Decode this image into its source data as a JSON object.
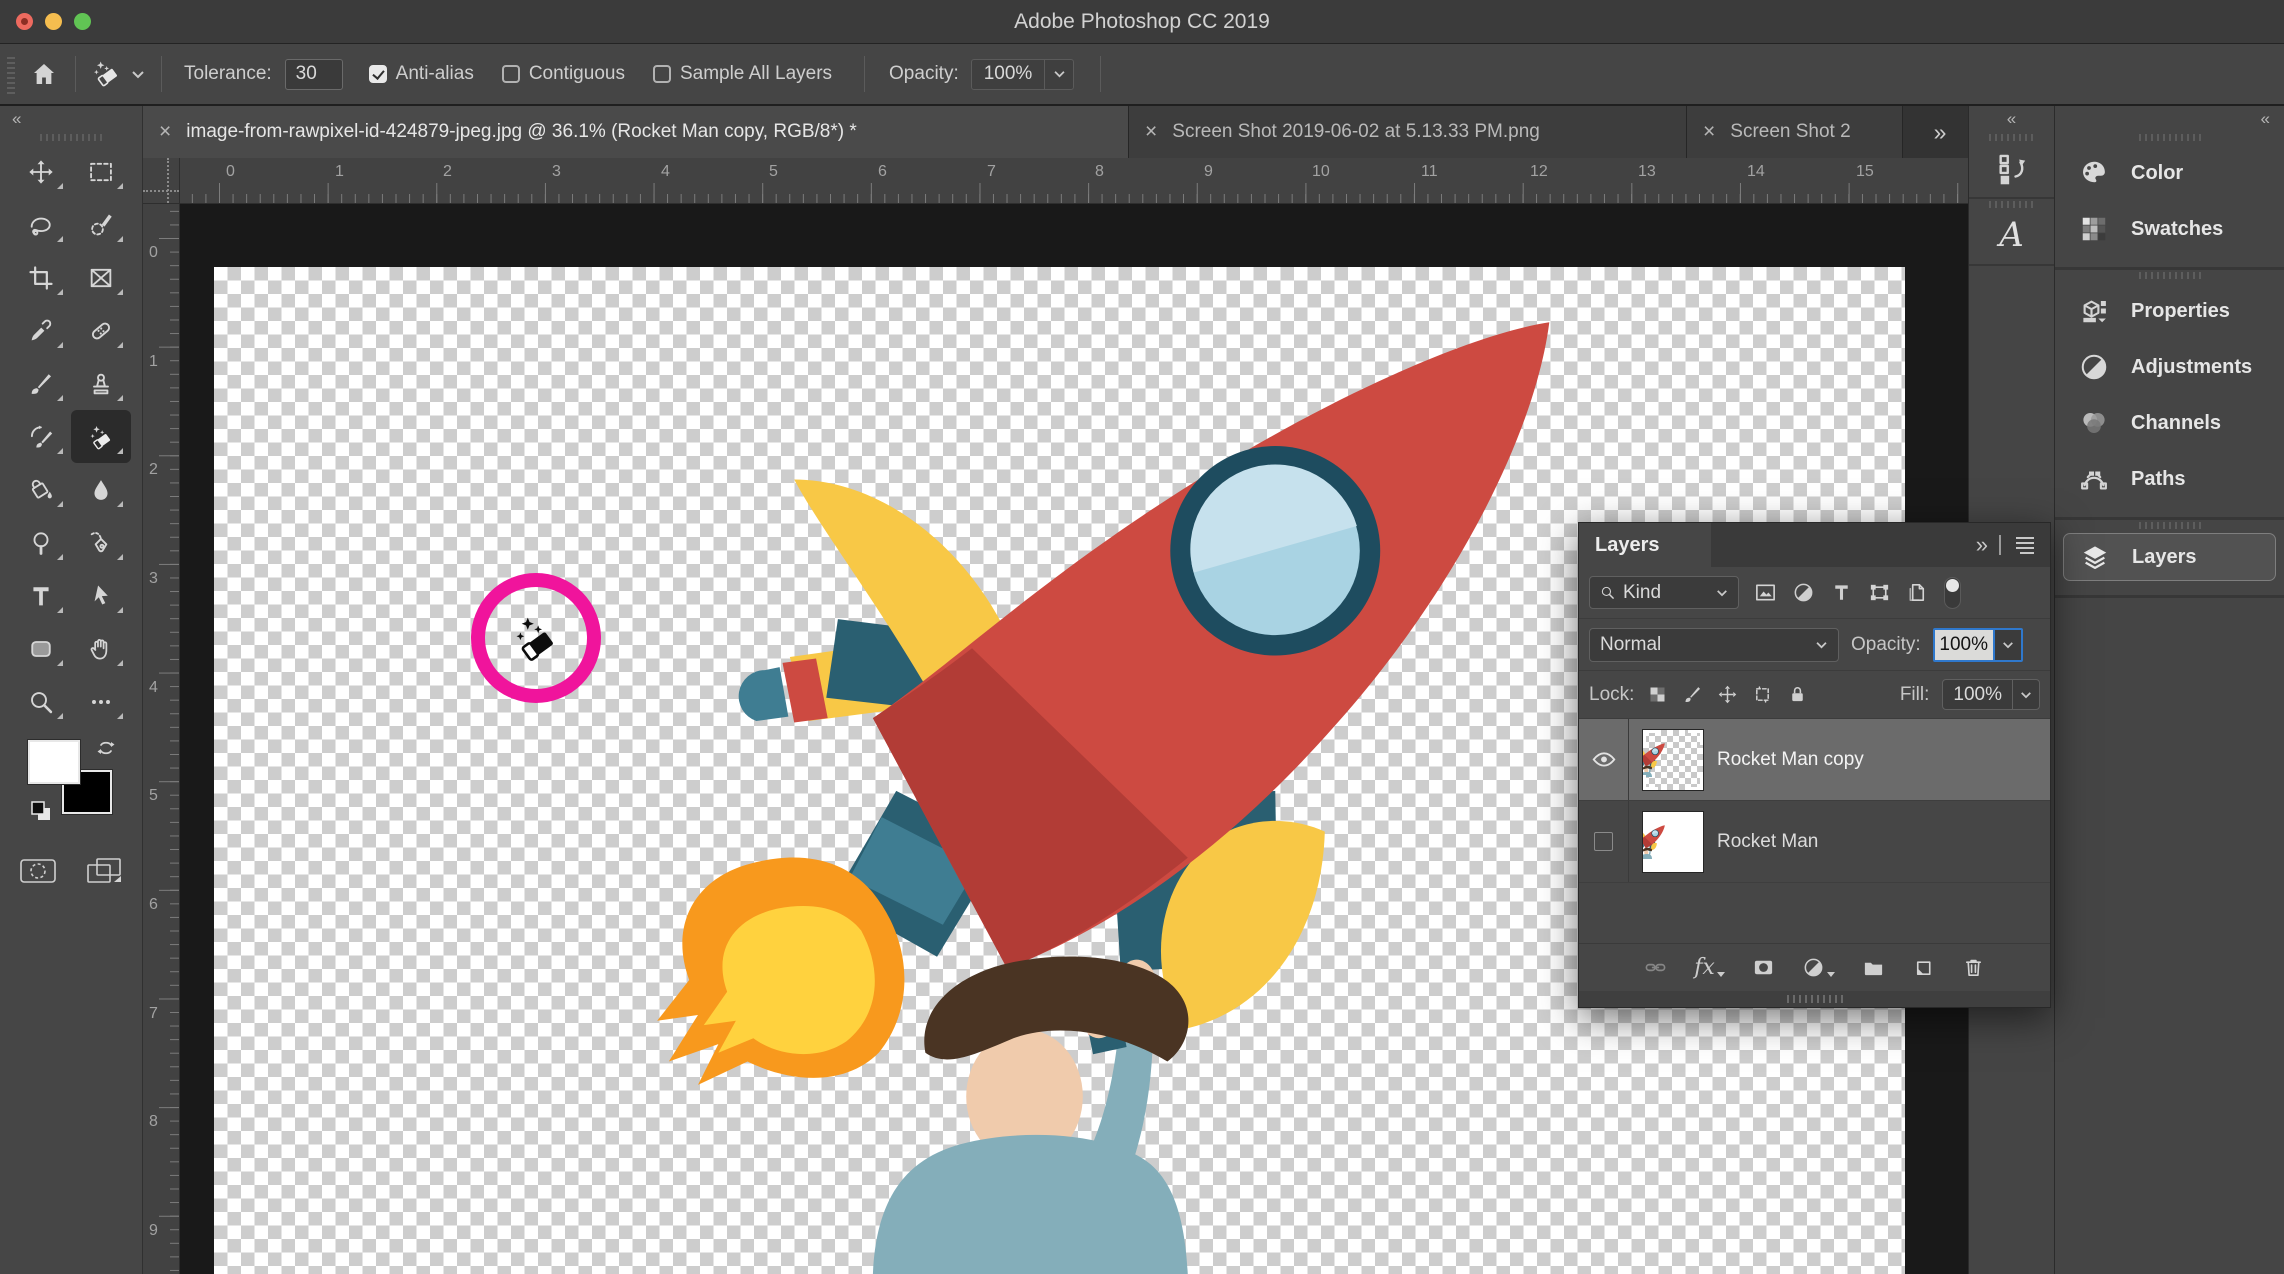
{
  "window": {
    "title": "Adobe Photoshop CC 2019"
  },
  "options_bar": {
    "tolerance_label": "Tolerance:",
    "tolerance_value": "30",
    "anti_alias_label": "Anti-alias",
    "anti_alias_checked": true,
    "contiguous_label": "Contiguous",
    "contiguous_checked": false,
    "sample_all_layers_label": "Sample All Layers",
    "sample_all_layers_checked": false,
    "opacity_label": "Opacity:",
    "opacity_value": "100%"
  },
  "tabs": [
    {
      "title": "image-from-rawpixel-id-424879-jpeg.jpg @ 36.1% (Rocket Man copy, RGB/8*) *",
      "active": true
    },
    {
      "title": "Screen Shot 2019-06-02 at 5.13.33 PM.png",
      "active": false
    },
    {
      "title": "Screen Shot 2",
      "active": false
    }
  ],
  "rulers": {
    "h": [
      "0",
      "1",
      "2",
      "3",
      "4",
      "5",
      "6",
      "7",
      "8",
      "9",
      "10",
      "11",
      "12",
      "13",
      "14",
      "15"
    ],
    "v": [
      "0",
      "1",
      "2",
      "3",
      "4",
      "5",
      "6",
      "7",
      "8",
      "9"
    ]
  },
  "tools": [
    "move",
    "rectangular-marquee",
    "lasso",
    "quick-selection",
    "crop",
    "frame",
    "eyedropper",
    "spot-healing-brush",
    "brush",
    "clone-stamp",
    "history-brush",
    "magic-eraser",
    "paint-bucket",
    "blur",
    "dodge",
    "pen",
    "type",
    "path-selection",
    "rectangle-shape",
    "hand",
    "zoom",
    "edit-toolbar"
  ],
  "selected_tool": "magic-eraser",
  "layers_panel": {
    "title": "Layers",
    "kind_label": "Kind",
    "blend_mode": "Normal",
    "opacity_label": "Opacity:",
    "opacity_value": "100%",
    "lock_label": "Lock:",
    "fill_label": "Fill:",
    "fill_value": "100%",
    "fx_label": "fx",
    "layers": [
      {
        "name": "Rocket Man copy",
        "visible": true,
        "selected": true
      },
      {
        "name": "Rocket Man",
        "visible": false,
        "selected": false
      }
    ]
  },
  "right_dock": {
    "panels": [
      {
        "label": "Color"
      },
      {
        "label": "Swatches"
      },
      {
        "label": "Properties"
      },
      {
        "label": "Adjustments"
      },
      {
        "label": "Channels"
      },
      {
        "label": "Paths"
      },
      {
        "label": "Layers",
        "selected": true
      }
    ]
  },
  "narrow_dock": {
    "glyphs_panel_letter": "A"
  },
  "icons": {
    "close": "×",
    "overflow": "»",
    "collapse": "«"
  },
  "colors": {
    "accent_blue": "#2f78cc",
    "cursor_pink": "#f0149c",
    "rocket_red": "#cd4a41",
    "rocket_yellow": "#f8c846",
    "flame_orange": "#f8991d",
    "panel_bg": "#464646",
    "pasteboard": "#191919"
  }
}
